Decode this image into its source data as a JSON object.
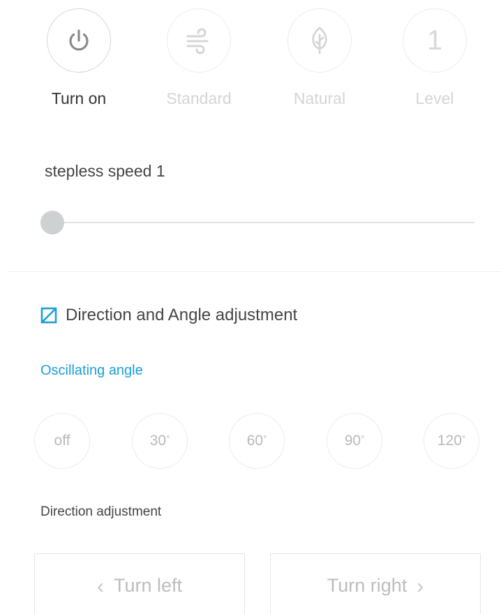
{
  "modes": [
    {
      "name": "power",
      "label": "Turn on",
      "icon": "power-icon",
      "active": true
    },
    {
      "name": "standard",
      "label": "Standard",
      "icon": "wind-icon",
      "active": false
    },
    {
      "name": "natural",
      "label": "Natural",
      "icon": "leaf-icon",
      "active": false
    },
    {
      "name": "level",
      "label": "Level",
      "icon_text": "1",
      "active": false
    }
  ],
  "speed": {
    "label": "stepless speed 1",
    "value_fraction": 0.0
  },
  "direction_section": {
    "icon": "direction-checkbox-icon",
    "title": "Direction and Angle adjustment",
    "accent_color": "#1a9fd8"
  },
  "oscillation": {
    "label": "Oscillating angle",
    "options": [
      {
        "text": "off",
        "deg": ""
      },
      {
        "text": "30",
        "deg": "°"
      },
      {
        "text": "60",
        "deg": "°"
      },
      {
        "text": "90",
        "deg": "°"
      },
      {
        "text": "120",
        "deg": "°"
      }
    ]
  },
  "direction": {
    "label": "Direction adjustment",
    "left_label": "Turn left",
    "right_label": "Turn right",
    "left_chevron": "‹",
    "right_chevron": "›"
  }
}
